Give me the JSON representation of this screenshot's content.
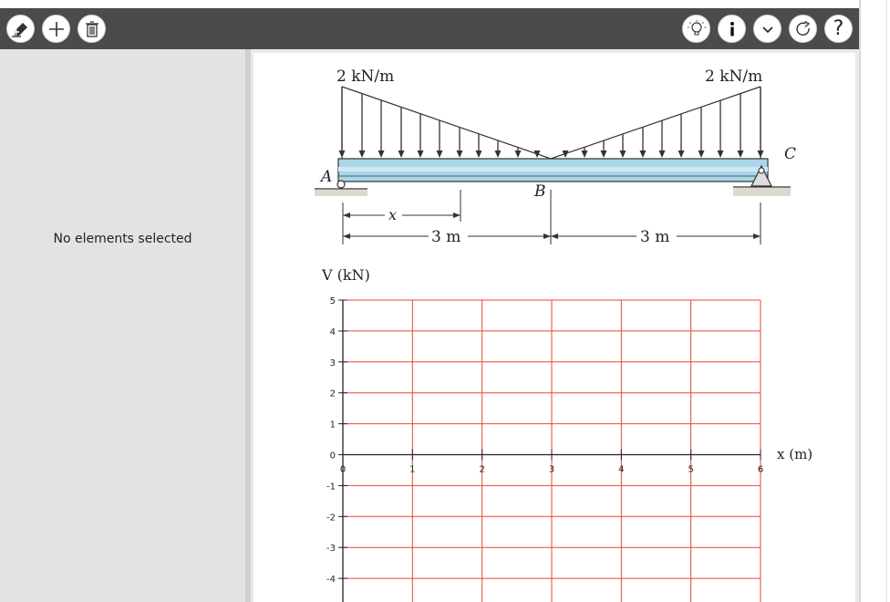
{
  "toolbar": {
    "left_buttons": [
      {
        "name": "add-element-button",
        "icon": "pencil-plus-icon"
      },
      {
        "name": "add-button",
        "icon": "plus-icon"
      },
      {
        "name": "delete-button",
        "icon": "trash-icon"
      }
    ],
    "right_buttons": [
      {
        "name": "hint-button",
        "icon": "lightbulb-icon"
      },
      {
        "name": "info-button",
        "icon": "info-icon"
      },
      {
        "name": "menu-button",
        "icon": "chevron-down-icon"
      },
      {
        "name": "reset-button",
        "icon": "redo-icon"
      },
      {
        "name": "help-button",
        "icon": "question-icon",
        "label": "?"
      }
    ]
  },
  "sidepanel": {
    "message": "No elements selected"
  },
  "figure": {
    "load_left": "2 kN/m",
    "load_right": "2 kN/m",
    "point_a": "A",
    "point_b": "B",
    "point_c": "C",
    "x_label": "x",
    "dim_left": "3 m",
    "dim_right": "3 m"
  },
  "chart_data": {
    "type": "line",
    "ylabel": "V (kN)",
    "xlabel": "x (m)",
    "xlim": [
      0,
      6
    ],
    "ylim": [
      -4,
      5
    ],
    "x_ticks": [
      "0",
      "1",
      "2",
      "3",
      "4",
      "5",
      "6"
    ],
    "y_ticks": [
      "5",
      "4",
      "3",
      "2",
      "1",
      "0",
      "-1",
      "-2",
      "-3",
      "-4"
    ],
    "grid": true,
    "grid_color": "#e8463c",
    "series": []
  }
}
